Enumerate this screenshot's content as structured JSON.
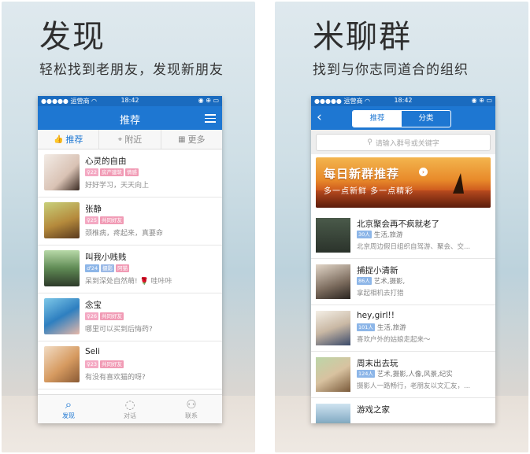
{
  "left_panel": {
    "title": "发现",
    "subtitle": "轻松找到老朋友，发现新朋友",
    "status": {
      "carrier": "●●●●● 运营商 ◠",
      "time": "18:42",
      "icons": "◉ ⊕ ▭"
    },
    "nav_title": "推荐",
    "subtabs": [
      {
        "icon": "thumbs-up-icon",
        "glyph": "👍",
        "label": "推荐"
      },
      {
        "icon": "location-pin-icon",
        "glyph": "⌖",
        "label": "附近"
      },
      {
        "icon": "grid-icon",
        "glyph": "▦",
        "label": "更多"
      }
    ],
    "friends": [
      {
        "name": "心灵的自由",
        "age": "♀22",
        "tags": [
          "房产建筑",
          "情感"
        ],
        "signature": "好好学习，天天向上"
      },
      {
        "name": "张静",
        "age": "♀25",
        "tags": [
          "共同好友"
        ],
        "signature": "颈椎病，疼起来，真要命"
      },
      {
        "name": "叫我小贱贱",
        "age": "♂24",
        "tags": [
          "摄影",
          "阿猫"
        ],
        "signature": "呆到深处自然萌! 🌹 哇咔咔"
      },
      {
        "name": "念宝",
        "age": "♀26",
        "tags": [
          "共同好友"
        ],
        "signature": "哪里可以买到后悔药?"
      },
      {
        "name": "Seli",
        "age": "♀23",
        "tags": [
          "共同好友"
        ],
        "signature": "有没有喜欢猫的呀?"
      }
    ],
    "tabbar": [
      {
        "icon": "discover-icon",
        "glyph": "⌕",
        "label": "发现"
      },
      {
        "icon": "chat-icon",
        "glyph": "◌",
        "label": "对话"
      },
      {
        "icon": "contacts-icon",
        "glyph": "⚇",
        "label": "联系"
      }
    ]
  },
  "right_panel": {
    "title": "米聊群",
    "subtitle": "找到与你志同道合的组织",
    "status": {
      "carrier": "●●●●● 运营商 ◠",
      "time": "18:42",
      "icons": "◉ ⊕ ▭"
    },
    "segments": [
      "推荐",
      "分类"
    ],
    "search_placeholder": "请输入群号或关键字",
    "banner": {
      "title": "每日新群推荐",
      "subtitle": "多一点新鲜  多一点精彩"
    },
    "groups": [
      {
        "name": "北京聚会再不疯就老了",
        "count": "30人",
        "tags": "生活,旅游",
        "desc": "北京周边假日组织自驾游、聚会、交..."
      },
      {
        "name": "捕捉小清新",
        "count": "86人",
        "tags": "艺术,摄影,",
        "desc": "拿起相机去打猎"
      },
      {
        "name": "hey,girl!!",
        "count": "101人",
        "tags": "生活,旅游",
        "desc": "喜欢户外的姑娘走起来～"
      },
      {
        "name": "周末出去玩",
        "count": "124人",
        "tags": "艺术,摄影,人像,风景,纪实",
        "desc": "摄影人一路畅行，老朋友以文汇友，..."
      },
      {
        "name": "游戏之家",
        "count": "",
        "tags": "",
        "desc": ""
      }
    ]
  },
  "colors": {
    "primary": "#1e77d2",
    "statusbar": "#1a6bbf"
  }
}
